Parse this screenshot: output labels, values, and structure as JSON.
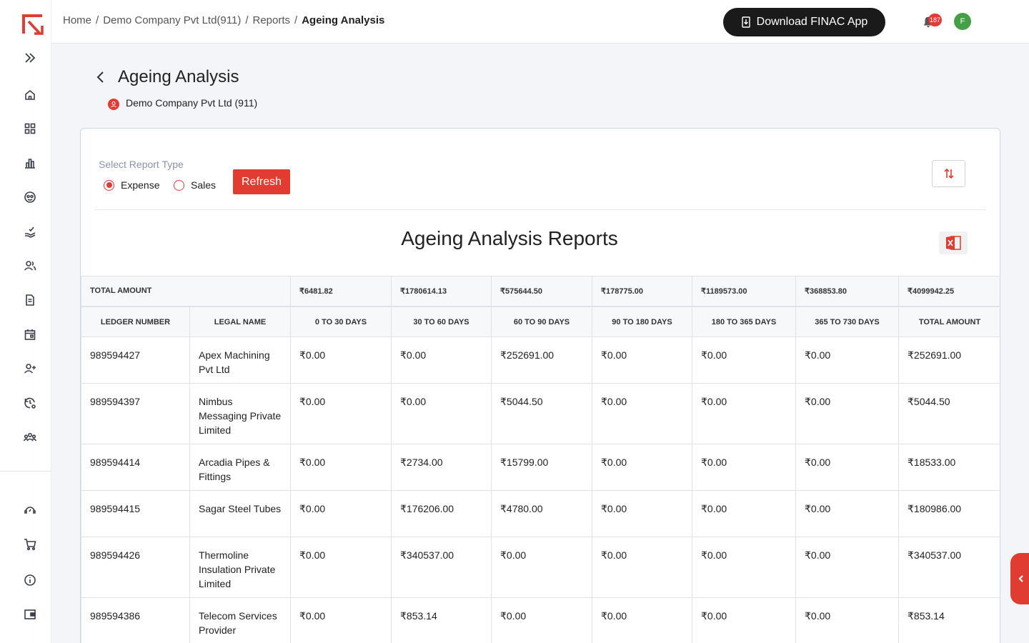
{
  "breadcrumb": {
    "home": "Home",
    "company": "Demo Company Pvt Ltd(911)",
    "reports": "Reports",
    "current": "Ageing Analysis"
  },
  "topbar": {
    "download_label": "Download FINAC App",
    "notification_count": "187",
    "avatar_initial": "F"
  },
  "page": {
    "title": "Ageing Analysis",
    "company": "Demo Company Pvt Ltd (911)"
  },
  "filters": {
    "report_type_label": "Select Report Type",
    "options": [
      "Expense",
      "Sales"
    ],
    "selected": "Expense",
    "refresh_label": "Refresh"
  },
  "report": {
    "title": "Ageing Analysis Reports"
  },
  "table": {
    "total_label": "TOTAL AMOUNT",
    "totals": [
      "₹6481.82",
      "₹1780614.13",
      "₹575644.50",
      "₹178775.00",
      "₹1189573.00",
      "₹368853.80",
      "₹4099942.25"
    ],
    "headers": [
      "LEDGER NUMBER",
      "LEGAL NAME",
      "0 TO 30 DAYS",
      "30 TO 60 DAYS",
      "60 TO 90 DAYS",
      "90 TO 180 DAYS",
      "180 TO 365 DAYS",
      "365 TO 730 DAYS",
      "TOTAL AMOUNT"
    ],
    "rows": [
      [
        "989594427",
        "Apex Machining Pvt Ltd",
        "₹0.00",
        "₹0.00",
        "₹252691.00",
        "₹0.00",
        "₹0.00",
        "₹0.00",
        "₹252691.00"
      ],
      [
        "989594397",
        "Nimbus Messaging Private Limited",
        "₹0.00",
        "₹0.00",
        "₹5044.50",
        "₹0.00",
        "₹0.00",
        "₹0.00",
        "₹5044.50"
      ],
      [
        "989594414",
        "Arcadia Pipes & Fittings",
        "₹0.00",
        "₹2734.00",
        "₹15799.00",
        "₹0.00",
        "₹0.00",
        "₹0.00",
        "₹18533.00"
      ],
      [
        "989594415",
        "Sagar Steel Tubes",
        "₹0.00",
        "₹176206.00",
        "₹4780.00",
        "₹0.00",
        "₹0.00",
        "₹0.00",
        "₹180986.00"
      ],
      [
        "989594426",
        "Thermoline Insulation Private Limited",
        "₹0.00",
        "₹340537.00",
        "₹0.00",
        "₹0.00",
        "₹0.00",
        "₹0.00",
        "₹340537.00"
      ],
      [
        "989594386",
        "Telecom Services Provider",
        "₹0.00",
        "₹853.14",
        "₹0.00",
        "₹0.00",
        "₹0.00",
        "₹0.00",
        "₹853.14"
      ]
    ]
  },
  "sidebar": {
    "icons": [
      "expand-icon",
      "home-icon",
      "dashboard-icon",
      "reports-icon",
      "support-icon",
      "payments-icon",
      "contacts-icon",
      "documents-icon",
      "calendar-icon",
      "add-user-icon",
      "history-settings-icon",
      "team-icon",
      "helpdesk-icon",
      "cart-icon",
      "info-icon",
      "wallet-icon"
    ]
  },
  "colors": {
    "accent": "#e03c31",
    "dark_button": "#1a1a1a"
  }
}
